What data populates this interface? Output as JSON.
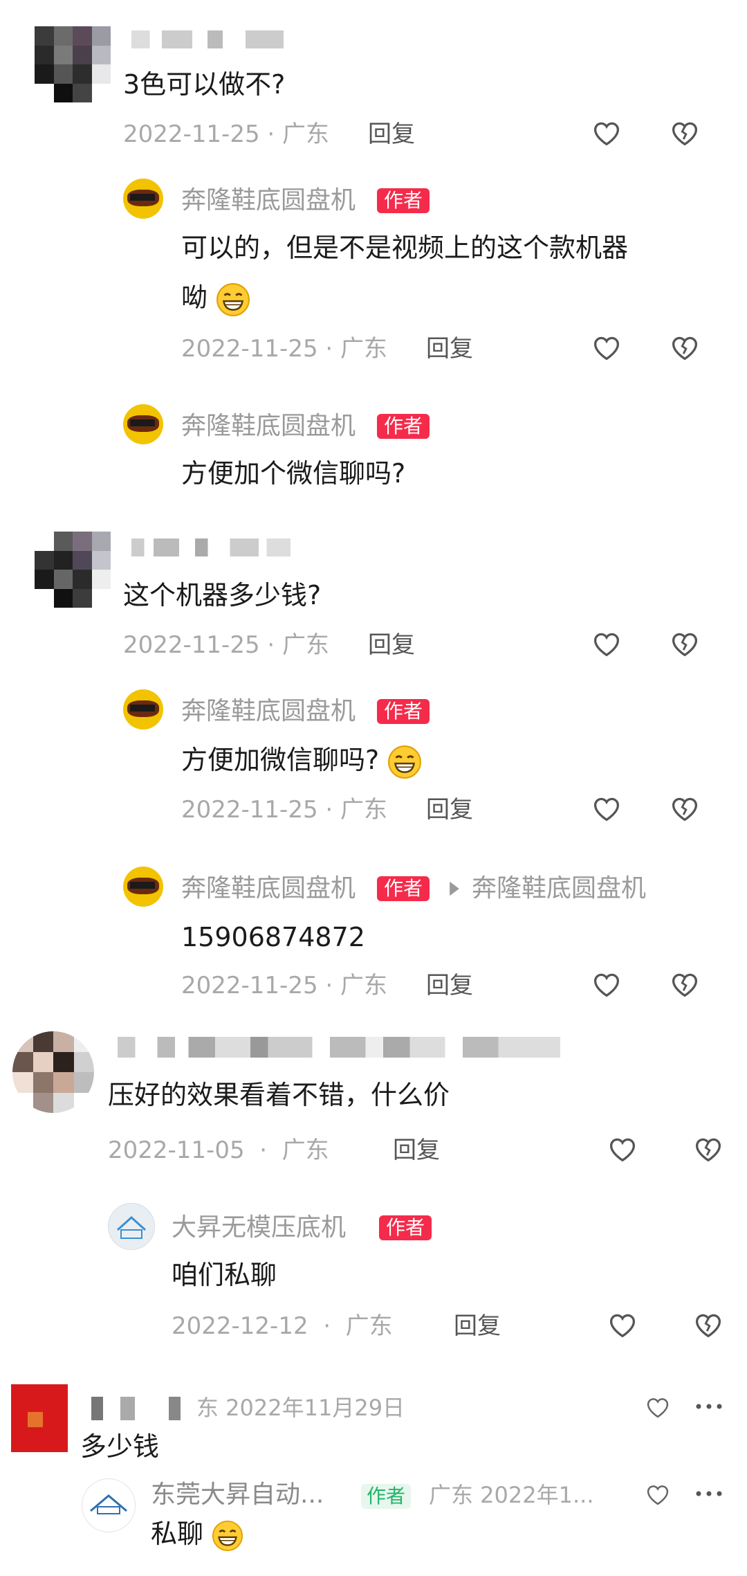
{
  "comments": [
    {
      "text": "3色可以做不?",
      "date": "2022-11-25",
      "sep": "·",
      "location": "广东",
      "reply_label": "回复",
      "replies": [
        {
          "name": "奔隆鞋底圆盘机",
          "tag": "作者",
          "line1": "可以的，但是不是视频上的这个款机器",
          "line2": "呦",
          "date": "2022-11-25",
          "sep": "·",
          "location": "广东",
          "reply_label": "回复"
        },
        {
          "name": "奔隆鞋底圆盘机",
          "tag": "作者",
          "line1": "方便加个微信聊吗?"
        }
      ]
    },
    {
      "text": "这个机器多少钱?",
      "date": "2022-11-25",
      "sep": "·",
      "location": "广东",
      "reply_label": "回复",
      "replies": [
        {
          "name": "奔隆鞋底圆盘机",
          "tag": "作者",
          "line1": "方便加微信聊吗?",
          "date": "2022-11-25",
          "sep": "·",
          "location": "广东",
          "reply_label": "回复"
        },
        {
          "name": "奔隆鞋底圆盘机",
          "tag": "作者",
          "reply_to": "奔隆鞋底圆盘机",
          "line1": "15906874872",
          "date": "2022-11-25",
          "sep": "·",
          "location": "广东",
          "reply_label": "回复"
        }
      ]
    },
    {
      "text": "压好的效果看着不错，什么价",
      "date": "2022-11-05",
      "sep": "·",
      "location": "广东",
      "reply_label": "回复",
      "replies": [
        {
          "name": "大昇无模压底机",
          "tag": "作者",
          "line1": "咱们私聊",
          "date": "2022-12-12",
          "sep": "·",
          "location": "广东",
          "reply_label": "回复"
        }
      ]
    },
    {
      "meta": "东 2022年11月29日",
      "text": "多少钱",
      "replies": [
        {
          "name": "东莞大昇自动...",
          "tag": "作者",
          "meta": "广东 2022年1...",
          "line1": "私聊"
        }
      ]
    }
  ],
  "colors": {
    "author_tag": "#f52b4b",
    "author_tag_green": "#23b46a",
    "meta": "#a8a8a8"
  },
  "icons": [
    "heart-icon",
    "broken-heart-icon",
    "more-icon",
    "grin-emoji"
  ]
}
